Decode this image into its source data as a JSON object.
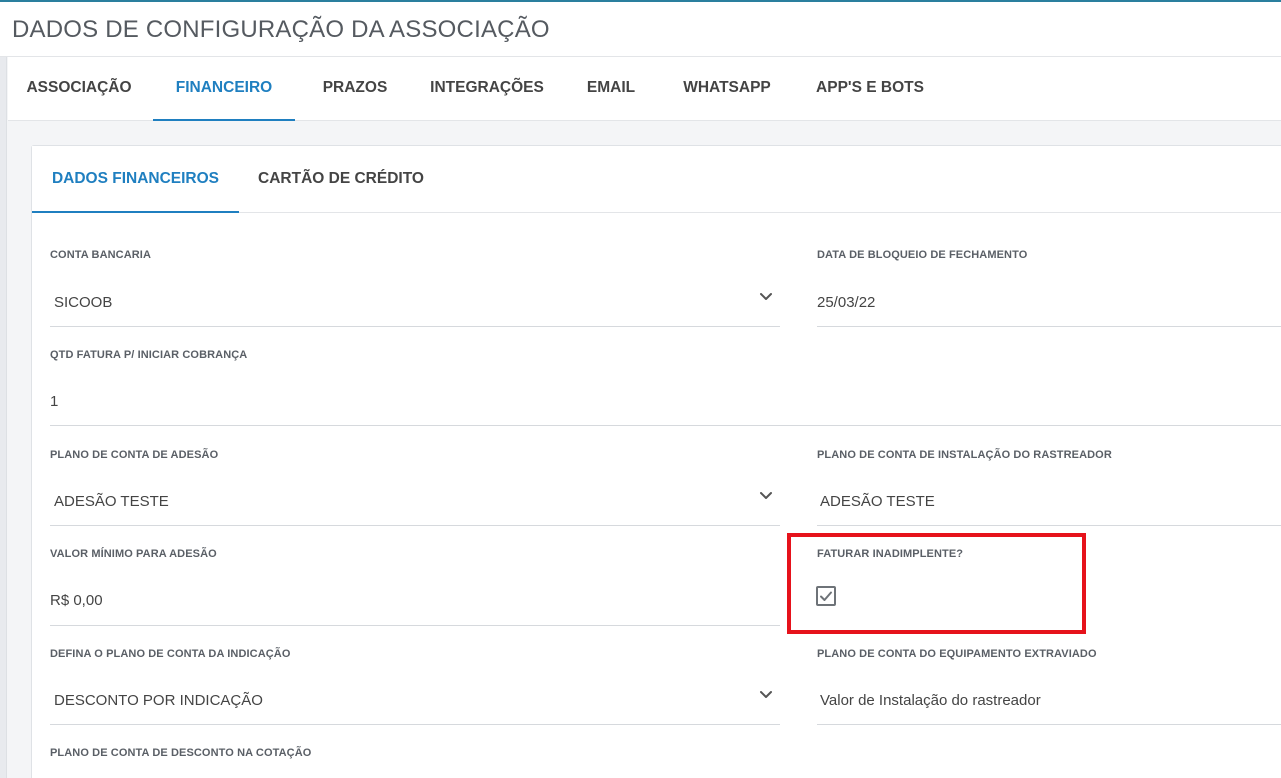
{
  "header": {
    "title": "DADOS DE CONFIGURAÇÃO DA ASSOCIAÇÃO"
  },
  "main_tabs": [
    {
      "label": "ASSOCIAÇÃO",
      "active": false
    },
    {
      "label": "FINANCEIRO",
      "active": true
    },
    {
      "label": "PRAZOS",
      "active": false
    },
    {
      "label": "INTEGRAÇÕES",
      "active": false
    },
    {
      "label": "EMAIL",
      "active": false
    },
    {
      "label": "WHATSAPP",
      "active": false
    },
    {
      "label": "APP'S E BOTS",
      "active": false
    }
  ],
  "sub_tabs": [
    {
      "label": "DADOS FINANCEIROS",
      "active": true
    },
    {
      "label": "CARTÃO DE CRÉDITO",
      "active": false
    }
  ],
  "fields": {
    "conta_bancaria": {
      "label": "CONTA BANCARIA",
      "value": "SICOOB"
    },
    "data_bloqueio": {
      "label": "DATA DE BLOQUEIO DE FECHAMENTO",
      "value": "25/03/22"
    },
    "qtd_fatura": {
      "label": "QTD FATURA P/ INICIAR COBRANÇA",
      "value": "1"
    },
    "plano_adesao": {
      "label": "PLANO DE CONTA DE ADESÃO",
      "value": "ADESÃO TESTE"
    },
    "plano_instalacao": {
      "label": "PLANO DE CONTA DE INSTALAÇÃO DO RASTREADOR",
      "value": "ADESÃO TESTE"
    },
    "valor_minimo": {
      "label": "VALOR MÍNIMO PARA ADESÃO",
      "value": "R$ 0,00"
    },
    "faturar_inadimplente": {
      "label": "FATURAR INADIMPLENTE?",
      "checked": true
    },
    "plano_indicacao": {
      "label": "DEFINA O PLANO DE CONTA DA INDICAÇÃO",
      "value": "DESCONTO POR INDICAÇÃO"
    },
    "plano_extraviado": {
      "label": "PLANO DE CONTA DO EQUIPAMENTO EXTRAVIADO",
      "value": "Valor de Instalação do rastreador"
    },
    "plano_desconto_cotacao": {
      "label": "PLANO DE CONTA DE DESCONTO NA COTAÇÃO"
    }
  },
  "colors": {
    "accent": "#1f7fc0",
    "highlight": "#e6121b",
    "top_line": "#2a7f9e"
  },
  "icons": {
    "select": "chevron-down-icon",
    "checkbox": "check-icon"
  }
}
